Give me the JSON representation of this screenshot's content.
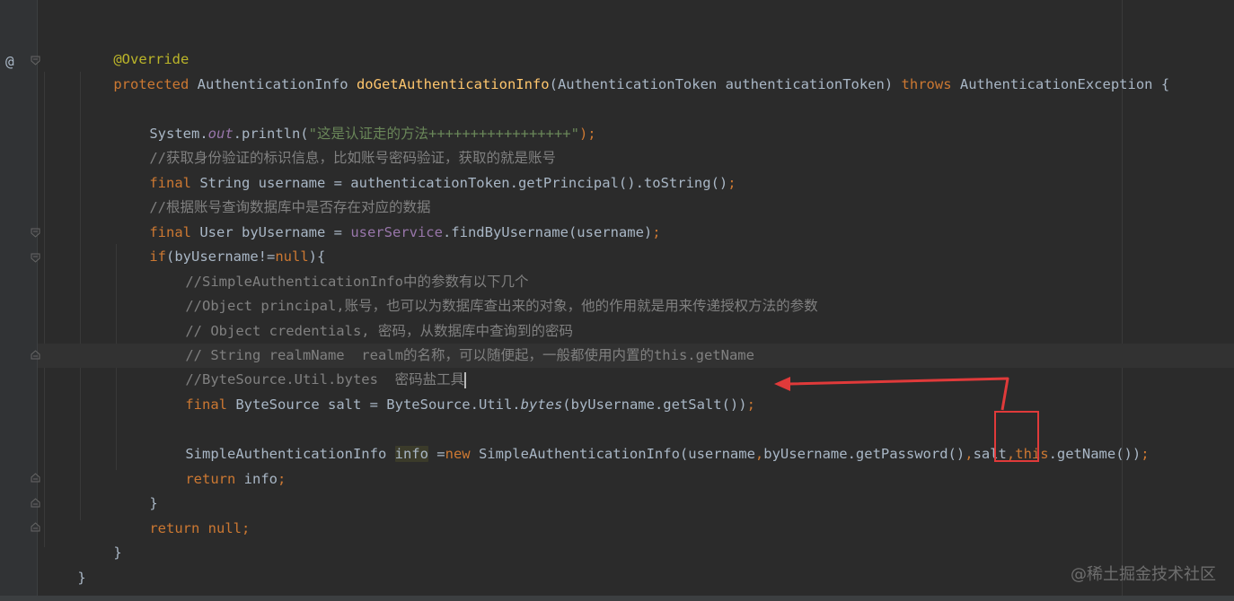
{
  "gutter": {
    "override_marker": "@"
  },
  "code": {
    "l1_annotation": "@Override",
    "l2_protected": "protected",
    "l2_return_type": " AuthenticationInfo ",
    "l2_method": "doGetAuthenticationInfo",
    "l2_params": "(AuthenticationToken authenticationToken) ",
    "l2_throws": "throws",
    "l2_exception": " AuthenticationException {",
    "l3_system": "System.",
    "l3_out": "out",
    "l3_println": ".println(",
    "l3_string": "\"这是认证走的方法+++++++++++++++++\"",
    "l3_end": ");",
    "l4_comment": "//获取身份验证的标识信息，比如账号密码验证，获取的就是账号",
    "l5_final": "final",
    "l5_rest": " String username = authenticationToken.getPrincipal().toString()",
    "l5_semi": ";",
    "l6_comment": "//根据账号查询数据库中是否存在对应的数据",
    "l7_final": "final",
    "l7_type": " User byUsername = ",
    "l7_field": "userService",
    "l7_call": ".findByUsername(username)",
    "l7_semi": ";",
    "l8_if": "if",
    "l8_cond": "(byUsername!=",
    "l8_null": "null",
    "l8_end": "){",
    "l9_comment": "//SimpleAuthenticationInfo中的参数有以下几个",
    "l10_comment": "//Object principal,账号，也可以为数据库查出来的对象，他的作用就是用来传递授权方法的参数",
    "l11_comment": "// Object credentials, 密码，从数据库中查询到的密码",
    "l12_comment": "// String realmName  realm的名称，可以随便起，一般都使用内置的this.getName",
    "l13_comment": "//ByteSource.Util.bytes  密码盐工具",
    "l14_final": "final",
    "l14_decl": " ByteSource salt = ByteSource.Util.",
    "l14_bytes": "bytes",
    "l14_args": "(byUsername.getSalt())",
    "l14_semi": ";",
    "l15_type": "SimpleAuthenticationInfo ",
    "l15_info": "info",
    "l15_assign": " =",
    "l15_new": "new",
    "l15_ctor": " SimpleAuthenticationInfo(username",
    "l15_c1": ",",
    "l15_pwd": "byUsername.getPassword()",
    "l15_c2": ",",
    "l15_salt": "salt",
    "l15_c3": ",",
    "l15_this": "this",
    "l15_getname": ".getName())",
    "l15_semi": ";",
    "l16_return": "return",
    "l16_info": " info",
    "l16_semi": ";",
    "l17_brace": "}",
    "l18_return": "return",
    "l18_null": " null",
    "l18_semi": ";",
    "l19_brace": "}",
    "l20_brace": "}"
  },
  "annotation": {
    "box_color": "#e03a3a",
    "arrow_color": "#e03a3a"
  },
  "watermark": "@稀土掘金技术社区"
}
